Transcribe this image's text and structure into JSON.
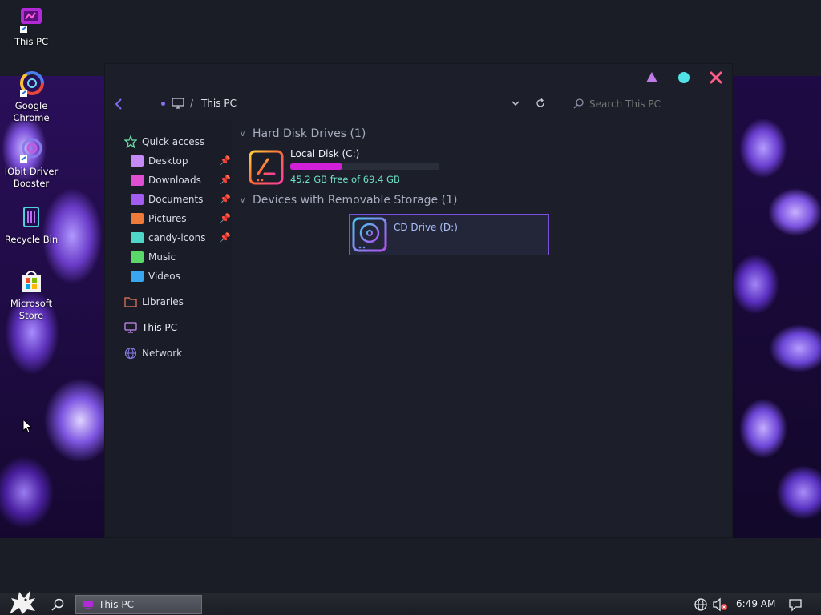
{
  "desktop": {
    "icons": [
      {
        "label": "This PC"
      },
      {
        "label": "Google Chrome"
      },
      {
        "label": "IObit Driver Booster"
      },
      {
        "label": "Recycle Bin"
      },
      {
        "label": "Microsoft Store"
      }
    ]
  },
  "window": {
    "controls": {
      "minimize": "minimize",
      "maximize": "maximize",
      "close": "close"
    },
    "address": {
      "separator": "/",
      "location": "This PC"
    },
    "search": {
      "placeholder": "Search This PC"
    }
  },
  "sidebar": {
    "quick_access": "Quick access",
    "items": [
      {
        "label": "Desktop",
        "pinned": true,
        "color": "#c58af5"
      },
      {
        "label": "Downloads",
        "pinned": true,
        "color": "#e04fd2"
      },
      {
        "label": "Documents",
        "pinned": true,
        "color": "#a35cf0"
      },
      {
        "label": "Pictures",
        "pinned": true,
        "color": "#f07a3a"
      },
      {
        "label": "candy-icons",
        "pinned": true,
        "color": "#4fd6c8"
      },
      {
        "label": "Music",
        "pinned": false,
        "color": "#5ad86a"
      },
      {
        "label": "Videos",
        "pinned": false,
        "color": "#3aa6f0"
      }
    ],
    "libraries": "Libraries",
    "this_pc": "This PC",
    "network": "Network"
  },
  "content": {
    "hard_disk_group": "Hard Disk Drives (1)",
    "removable_group": "Devices with Removable Storage (1)",
    "local_disk": {
      "name": "Local Disk (C:)",
      "free_text": "45.2 GB free of 69.4 GB",
      "used_fraction": 0.35
    },
    "cd_drive": {
      "name": "CD Drive (D:)"
    }
  },
  "taskbar": {
    "task_label": "This PC",
    "time": "6:49 AM"
  },
  "colors": {
    "accent": "#7a4fe0",
    "progress": "#d21fd8",
    "close": "#ff5c8a",
    "maximize": "#4fe3e8",
    "minimize": "#c07ae8"
  }
}
